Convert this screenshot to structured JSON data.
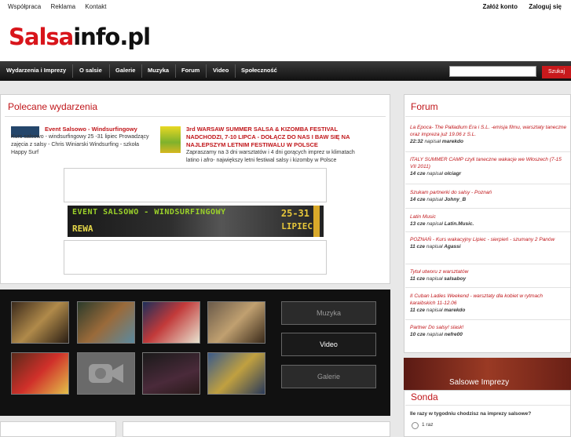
{
  "top_links": [
    "Współpraca",
    "Reklama",
    "Kontakt"
  ],
  "account": {
    "register": "Załóż konto",
    "login": "Zaloguj się"
  },
  "logo": {
    "part1": "Salsa",
    "part2": "info.pl"
  },
  "nav": [
    "Wydarzenia i Imprezy",
    "O salsie",
    "Galerie",
    "Muzyka",
    "Forum",
    "Video",
    "Społeczność"
  ],
  "search": {
    "value": "",
    "button": "Szukaj"
  },
  "featured": {
    "title": "Polecane wydarzenia",
    "events": [
      {
        "title": "Event Salsowo - Windsurfingowy",
        "desc": "Kurs salsowo - windsurfingowy 25 -31 lipiec Prowadzący zajęcia z salsy - Chris Winiarski Windsurfing - szkoła Happy Surf"
      },
      {
        "title": "3rd WARSAW SUMMER SALSA & KIZOMBA FESTIVAL NADCHODZI, 7-10 LIPCA - DOŁĄCZ DO NAS I BAW SIĘ NA NAJLEPSZYM LETNIM FESTIWALU W POLSCE",
        "desc": "Zapraszamy na 3 dni warsztatów i 4 dni gorących imprez w klimatach latino i afro- największy letni festiwal salsy i kizomby w Polsce"
      }
    ],
    "banner": {
      "line1": "EVENT SALSOWO - WINDSURFINGOWY",
      "line2": "REWA",
      "date1": "25-31",
      "date2": "LIPIEC"
    }
  },
  "media_buttons": [
    "Muzyka",
    "Video",
    "Galerie"
  ],
  "forum": {
    "title": "Forum",
    "posts": [
      {
        "title": "La Epoca- The Palladium Era i S.L. -emisja filmu, warsztaty taneczne oraz impreza już 19.06 z S.L.",
        "date": "22:32",
        "by": "napisał",
        "user": "marekdo"
      },
      {
        "title": "ITALY SUMMER CAMP czyli taneczne wakacje we Włoszech (7-15 VII 2011)",
        "date": "14 cze",
        "by": "napisał",
        "user": "olciagr"
      },
      {
        "title": "Szukam partnerki do salsy - Poznań",
        "date": "14 cze",
        "by": "napisał",
        "user": "Johny_B"
      },
      {
        "title": "Latin Music",
        "date": "13 cze",
        "by": "napisał",
        "user": "Latin.Music."
      },
      {
        "title": "POZNAŃ - Kurs wakacyjny Lipiec - sierpień - szumany 2 Panów",
        "date": "11 cze",
        "by": "napisał",
        "user": "Agassi"
      },
      {
        "title": "Tytuł utworu z warsztatów",
        "date": "11 cze",
        "by": "napisał",
        "user": "salsaboy"
      },
      {
        "title": "II Cuban Ladies Weekend - warsztaty dla kobiet w rytmach karaibskich 11-12.06",
        "date": "11 cze",
        "by": "napisał",
        "user": "marekdo"
      },
      {
        "title": "Partner Do salsy! slask!",
        "date": "10 cze",
        "by": "napisał",
        "user": "nefre00"
      }
    ]
  },
  "promo": "Salsowe Imprezy",
  "poll": {
    "title": "Sonda",
    "question": "Ile razy w tygodniu chodzisz na imprezy salsowe?",
    "option1": "1 raz"
  },
  "colors": {
    "brand_red": "#c0161a",
    "nav_bg": "#1e1e1e"
  }
}
